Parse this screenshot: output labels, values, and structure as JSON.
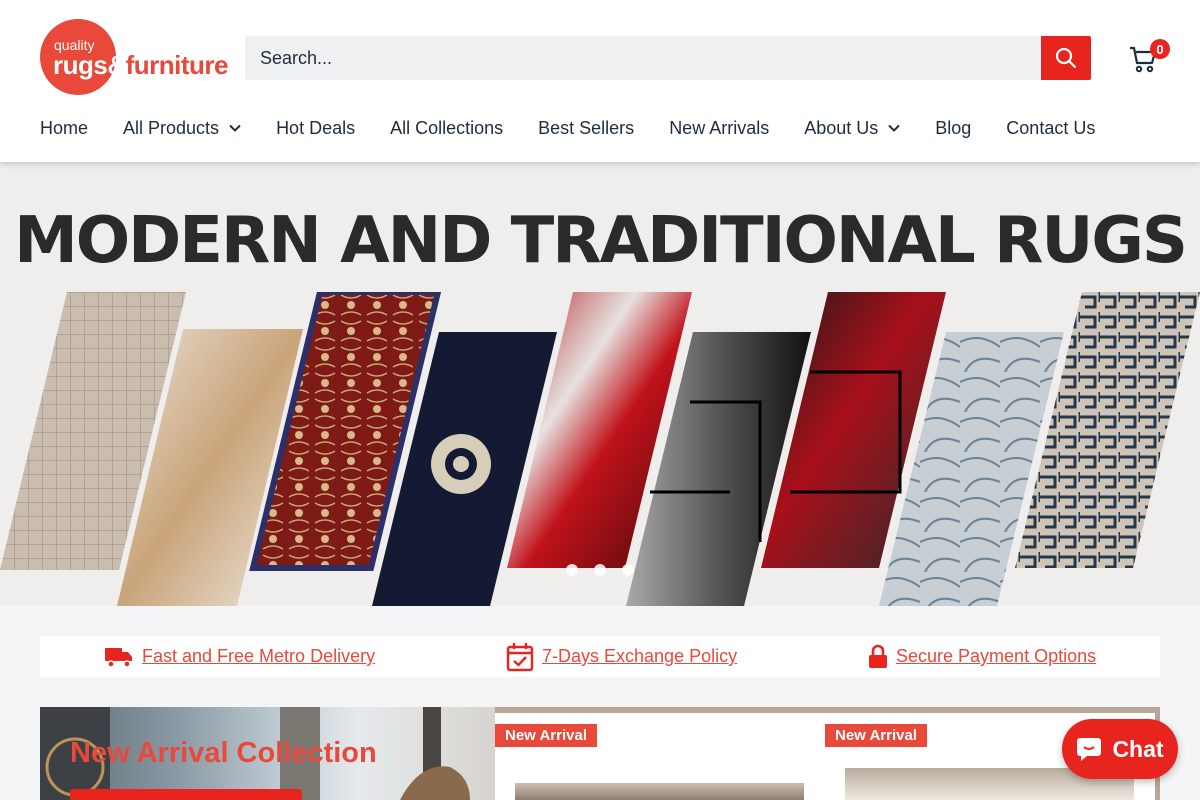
{
  "logo": {
    "small": "quality",
    "main": "rugs&",
    "tail": "furniture"
  },
  "search": {
    "placeholder": "Search..."
  },
  "cart": {
    "count": "0"
  },
  "nav": [
    {
      "label": "Home"
    },
    {
      "label": "All Products"
    },
    {
      "label": "Hot Deals"
    },
    {
      "label": "All Collections"
    },
    {
      "label": "Best Sellers"
    },
    {
      "label": "New Arrivals"
    },
    {
      "label": "About Us"
    },
    {
      "label": "Blog"
    },
    {
      "label": "Contact Us"
    }
  ],
  "hero": {
    "title": "MODERN AND TRADITIONAL RUGS",
    "slides": 3
  },
  "features": [
    {
      "icon": "truck-icon",
      "label": "Fast and Free Metro Delivery"
    },
    {
      "icon": "calendar-check-icon",
      "label": "7-Days Exchange Policy"
    },
    {
      "icon": "lock-icon",
      "label": "Secure Payment Options"
    }
  ],
  "promo": {
    "title": "New Arrival Collection"
  },
  "products": [
    {
      "badge": "New Arrival"
    },
    {
      "badge": "New Arrival"
    }
  ],
  "chat": {
    "label": "Chat"
  },
  "colors": {
    "accent": "#e8493a",
    "button_red": "#e8241f",
    "text": "#1e2d3d"
  }
}
